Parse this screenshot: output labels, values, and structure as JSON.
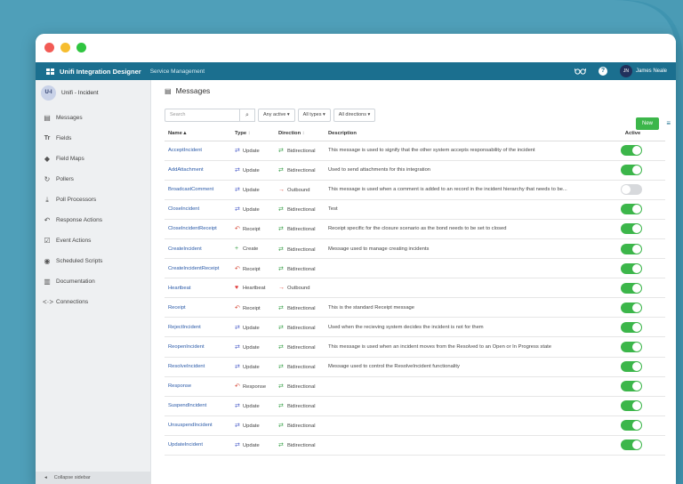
{
  "app": {
    "title": "Unifi Integration Designer",
    "section": "Service Management",
    "user_initials": "JN",
    "user_name": "James Neale"
  },
  "sidebar": {
    "avatar": "U-I",
    "title": "Unifi - Incident",
    "items": [
      {
        "label": "Messages",
        "icon": "messages-icon"
      },
      {
        "label": "Fields",
        "icon": "fields-icon"
      },
      {
        "label": "Field Maps",
        "icon": "field-maps-icon"
      },
      {
        "label": "Pollers",
        "icon": "pollers-icon"
      },
      {
        "label": "Poll Processors",
        "icon": "download-icon"
      },
      {
        "label": "Response Actions",
        "icon": "reply-icon"
      },
      {
        "label": "Event Actions",
        "icon": "check-box-icon"
      },
      {
        "label": "Scheduled Scripts",
        "icon": "play-circle-icon"
      },
      {
        "label": "Documentation",
        "icon": "book-icon"
      },
      {
        "label": "Connections",
        "icon": "connections-icon"
      }
    ],
    "collapse_label": "Collapse sidebar"
  },
  "main": {
    "title": "Messages",
    "new_label": "New",
    "search_placeholder": "Search",
    "filters": [
      "Any active",
      "All types",
      "All directions"
    ],
    "columns": {
      "name": "Name",
      "type": "Type",
      "direction": "Direction",
      "description": "Description",
      "active": "Active"
    },
    "rows": [
      {
        "name": "AcceptIncident",
        "type": "Update",
        "direction": "Bidirectional",
        "description": "This message is used to signify that the other system accepts responsability of the incident",
        "active": true
      },
      {
        "name": "AddAttachment",
        "type": "Update",
        "direction": "Bidirectional",
        "description": "Used to send attachments for this integration",
        "active": true
      },
      {
        "name": "BroadcastComment",
        "type": "Update",
        "direction": "Outbound",
        "description": "This message is used when a comment is added to an record in the incident hierarchy that needs to be...",
        "active": false
      },
      {
        "name": "CloseIncident",
        "type": "Update",
        "direction": "Bidirectional",
        "description": "Test",
        "active": true
      },
      {
        "name": "CloseIncidentReceipt",
        "type": "Receipt",
        "direction": "Bidirectional",
        "description": "Receipt specific for the closure scenario as the bond needs to be set to closed",
        "active": true
      },
      {
        "name": "CreateIncident",
        "type": "Create",
        "direction": "Bidirectional",
        "description": "Message used to manage creating incidents",
        "active": true
      },
      {
        "name": "CreateIncidentReceipt",
        "type": "Receipt",
        "direction": "Bidirectional",
        "description": "",
        "active": true
      },
      {
        "name": "Heartbeat",
        "type": "Heartbeat",
        "direction": "Outbound",
        "description": "",
        "active": true
      },
      {
        "name": "Receipt",
        "type": "Receipt",
        "direction": "Bidirectional",
        "description": "This is the standard Receipt message",
        "active": true
      },
      {
        "name": "RejectIncident",
        "type": "Update",
        "direction": "Bidirectional",
        "description": "Used when the recieving system decides the incident is not for them",
        "active": true
      },
      {
        "name": "ReopenIncident",
        "type": "Update",
        "direction": "Bidirectional",
        "description": "This message is used when an incident moves from the Resolved to an Open or In Progress state",
        "active": true
      },
      {
        "name": "ResolveIncident",
        "type": "Update",
        "direction": "Bidirectional",
        "description": "Message used to control the ResolveIncident functionality",
        "active": true
      },
      {
        "name": "Response",
        "type": "Response",
        "direction": "Bidirectional",
        "description": "",
        "active": true
      },
      {
        "name": "SuspendIncident",
        "type": "Update",
        "direction": "Bidirectional",
        "description": "",
        "active": true
      },
      {
        "name": "UnsuspendIncident",
        "type": "Update",
        "direction": "Bidirectional",
        "description": "",
        "active": true
      },
      {
        "name": "UpdateIncident",
        "type": "Update",
        "direction": "Bidirectional",
        "description": "",
        "active": true
      }
    ]
  },
  "colors": {
    "appbar": "#1b6f8f",
    "toggle_on": "#3cb64a",
    "toggle_off": "#d7d9dc",
    "link": "#2a5aa8"
  }
}
